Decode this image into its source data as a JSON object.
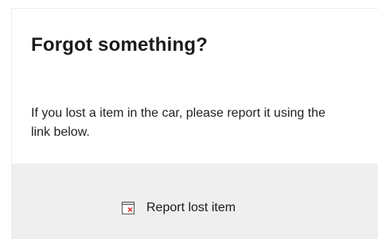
{
  "card": {
    "title": "Forgot something?",
    "description": "If you lost a item in the car, please report it using the link below."
  },
  "footer": {
    "report_link": {
      "label": "Report lost item",
      "icon": "broken-image-icon"
    }
  },
  "colors": {
    "footer_background": "#efefef",
    "icon_accent": "#d9302a"
  }
}
